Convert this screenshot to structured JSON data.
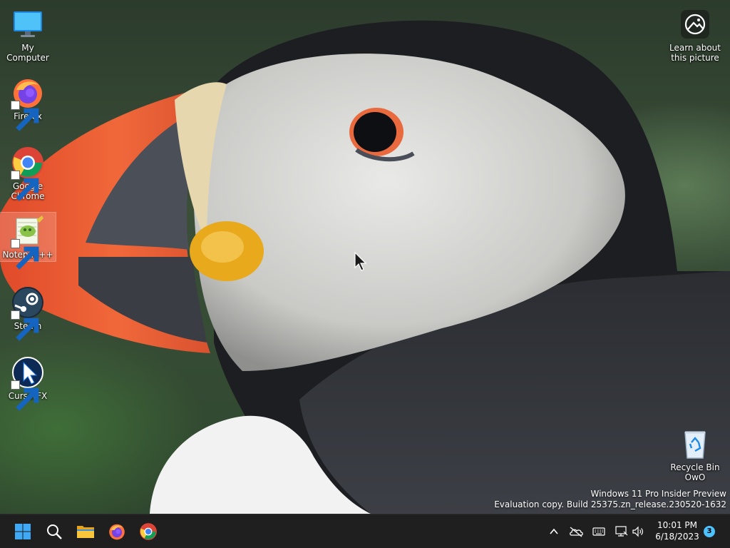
{
  "desktop": {
    "icons": [
      {
        "label": "My Computer",
        "icon": "monitor-icon"
      },
      {
        "label": "Firefox",
        "icon": "firefox-icon",
        "shortcut": true
      },
      {
        "label": "Google Chrome",
        "icon": "chrome-icon",
        "shortcut": true
      },
      {
        "label": "Notepad++",
        "icon": "notepadpp-icon",
        "shortcut": true,
        "selected": true
      },
      {
        "label": "Steam",
        "icon": "steam-icon",
        "shortcut": true
      },
      {
        "label": "CursorFX",
        "icon": "cursorfx-icon",
        "shortcut": true
      },
      {
        "label": "Learn about this picture",
        "icon": "learn-about-picture-icon"
      },
      {
        "label": "Recycle Bin OwO",
        "icon": "recycle-bin-icon"
      }
    ],
    "watermark": {
      "line1": "Windows 11 Pro Insider Preview",
      "line2": "Evaluation copy. Build 25375.zn_release.230520-1632"
    }
  },
  "taskbar": {
    "pinned": [
      {
        "name": "start",
        "icon": "windows-start-icon"
      },
      {
        "name": "search",
        "icon": "search-icon"
      },
      {
        "name": "file-explorer",
        "icon": "folder-icon"
      },
      {
        "name": "firefox",
        "icon": "firefox-icon"
      },
      {
        "name": "chrome",
        "icon": "chrome-icon"
      }
    ],
    "tray": {
      "icons": [
        "chevron-up-icon",
        "onedrive-offline-icon",
        "keyboard-icon",
        "network-icon",
        "volume-icon"
      ],
      "time": "10:01 PM",
      "date": "6/18/2023",
      "notification_count": "3"
    }
  },
  "colors": {
    "taskbar_bg": "#1f1f1f",
    "accent": "#4cc2ff",
    "windows_logo": "#3fa9f5"
  }
}
